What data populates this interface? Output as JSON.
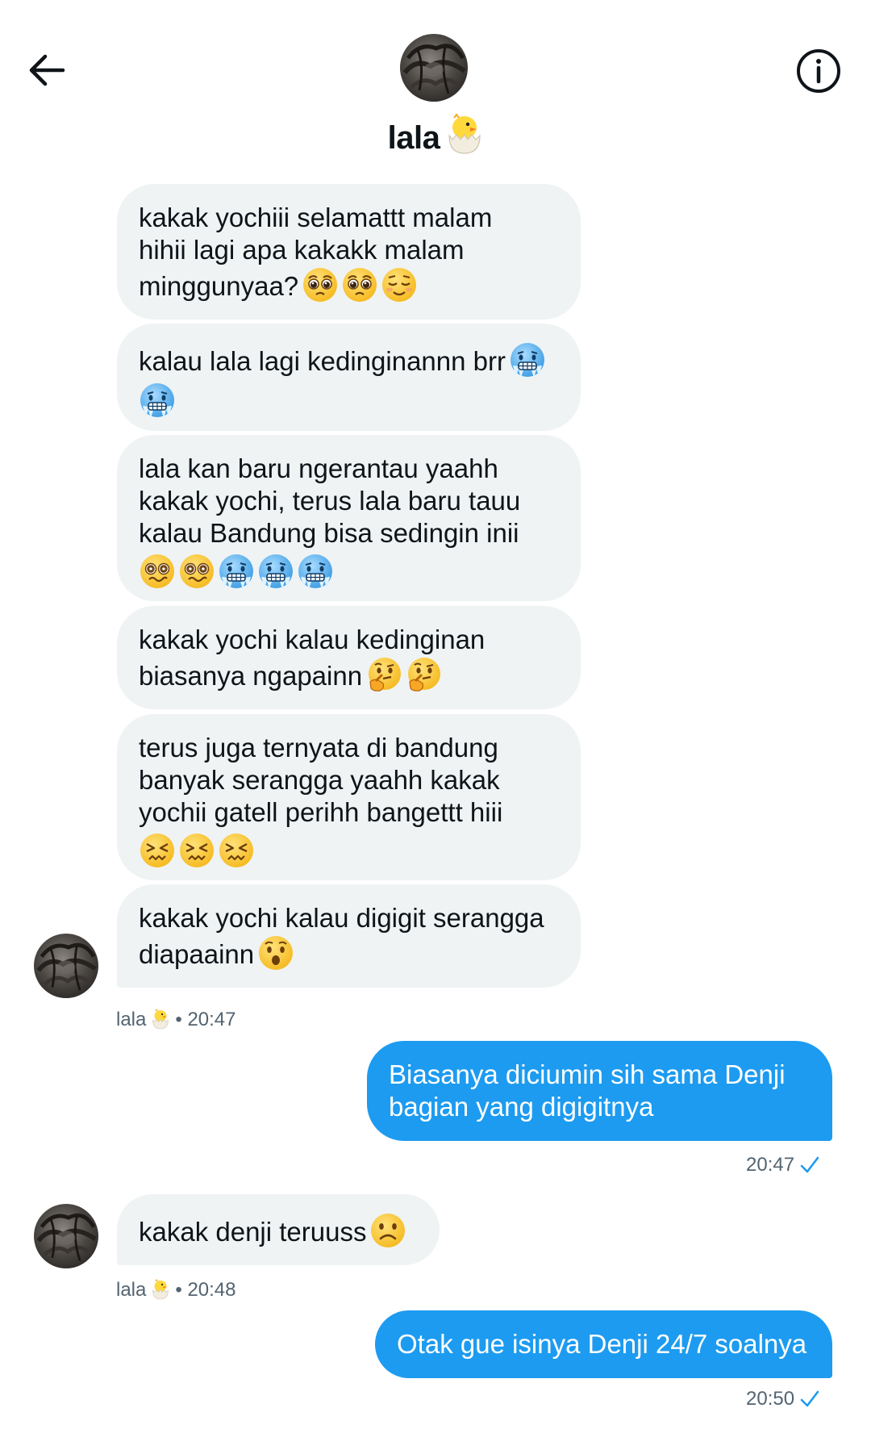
{
  "header": {
    "name": "lala"
  },
  "messages": {
    "m1": "kakak yochiii selamattt malam\nhihii lagi apa kakakk malam\nminggunyaa?",
    "m2": "kalau lala lagi kedinginannn brr",
    "m3": "lala kan baru ngerantau yaahh\nkakak yochi, terus lala baru tauu\nkalau Bandung bisa sedingin inii",
    "m4": "kakak yochi kalau kedinginan\nbiasanya ngapainn",
    "m5": "terus juga ternyata di bandung\nbanyak serangga yaahh kakak\nyochii gatell perihh bangettt hiii",
    "m6": "kakak yochi kalau digigit serangga\ndiapaainn",
    "m7": "Biasanya diciumin sih sama Denji\nbagian yang digigitnya",
    "m8": "kakak denji teruuss",
    "m9": "Otak gue isinya Denji 24/7 soalnya"
  },
  "meta": {
    "lala_name": "lala",
    "dot": "•",
    "t1": "20:47",
    "t2": "20:47",
    "t3": "20:48",
    "t4": "20:50"
  },
  "icons": {
    "back": "arrow-left-icon",
    "info": "info-icon",
    "check": "check-icon",
    "chick": "hatching-chick-emoji"
  },
  "colors": {
    "incoming_bubble": "#eff3f4",
    "outgoing_bubble": "#1d9bf0",
    "meta_text": "#536471",
    "check": "#1d9bf0"
  }
}
